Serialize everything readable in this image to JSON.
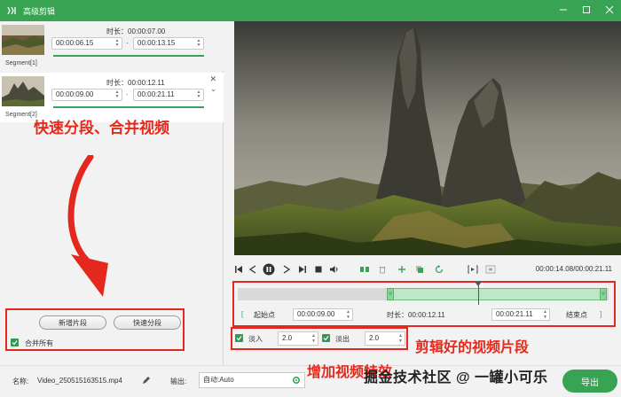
{
  "window": {
    "title": "高级剪辑"
  },
  "segments": [
    {
      "label": "Segment[1]",
      "duration": "时长：00:00:07.00",
      "start": "00:00:06.15",
      "end": "00:00:13.15",
      "dash": "-"
    },
    {
      "label": "Segment[2]",
      "duration": "时长：00:00:12.11",
      "start": "00:00:09.00",
      "end": "00:00:21.11",
      "dash": "-"
    }
  ],
  "left_actions": {
    "add_segment": "新增片段",
    "quick_split": "快速分段",
    "merge_all": "合并所有"
  },
  "player": {
    "time_readout": "00:00:14.08/00:00:21.11"
  },
  "timeline": {
    "start_bracket": "[",
    "start_label": "起始点",
    "start_value": "00:00:09.00",
    "duration": "时长：00:00:12.11",
    "end_value": "00:00:21.11",
    "end_label": "结束点",
    "end_bracket": "]"
  },
  "effects": {
    "fade_in_label": "淡入",
    "fade_in_value": "2.0",
    "fade_out_label": "淡出",
    "fade_out_value": "2.0"
  },
  "bottom": {
    "name_label": "名称:",
    "file_name": "Video_250515163515.mp4",
    "output_label": "输出:",
    "output_value": "自动:Auto",
    "export_label": "导出"
  },
  "annotations": {
    "split_merge": "快速分段、合并视频",
    "clipped_segments": "剪辑好的视频片段",
    "add_effects": "增加视频特效",
    "watermark": "掘金技术社区 @ 一罐小可乐"
  },
  "colors": {
    "accent": "#38a352",
    "annotation": "#e8281a"
  }
}
